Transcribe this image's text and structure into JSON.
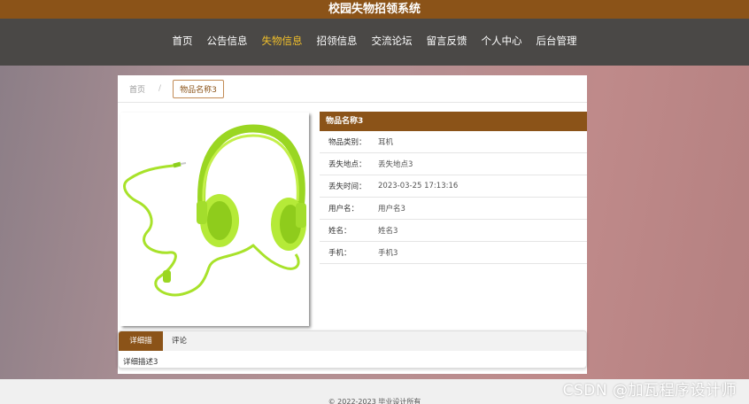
{
  "site": {
    "title": "校园失物招领系统"
  },
  "nav": {
    "items": [
      {
        "label": "首页"
      },
      {
        "label": "公告信息"
      },
      {
        "label": "失物信息"
      },
      {
        "label": "招领信息"
      },
      {
        "label": "交流论坛"
      },
      {
        "label": "留言反馈"
      },
      {
        "label": "个人中心"
      },
      {
        "label": "后台管理"
      }
    ],
    "active": "失物信息",
    "active_color": "#f2c02b"
  },
  "breadcrumb": {
    "home": "首页",
    "separator": "/",
    "current": "物品名称3"
  },
  "detail": {
    "header": "物品名称3",
    "rows": [
      {
        "label": "物品类别：",
        "value": "耳机"
      },
      {
        "label": "丢失地点：",
        "value": "丢失地点3"
      },
      {
        "label": "丢失时间：",
        "value": "2023-03-25 17:13:16"
      },
      {
        "label": "用户名：",
        "value": "用户名3"
      },
      {
        "label": "姓名：",
        "value": "姓名3"
      },
      {
        "label": "手机：",
        "value": "手机3"
      }
    ]
  },
  "image": {
    "icon": "headphones-photo"
  },
  "tabs": {
    "items": [
      {
        "label": "详细描述"
      },
      {
        "label": "评论"
      }
    ],
    "content": "详细描述3"
  },
  "footer": {
    "text": "© 2022-2023 毕业设计所有"
  },
  "watermark": {
    "text": "CSDN @加瓦程序设计师"
  },
  "colors": {
    "brand": "#8b5318",
    "nav_bg": "#4a4846",
    "accent": "#f2c02b"
  }
}
